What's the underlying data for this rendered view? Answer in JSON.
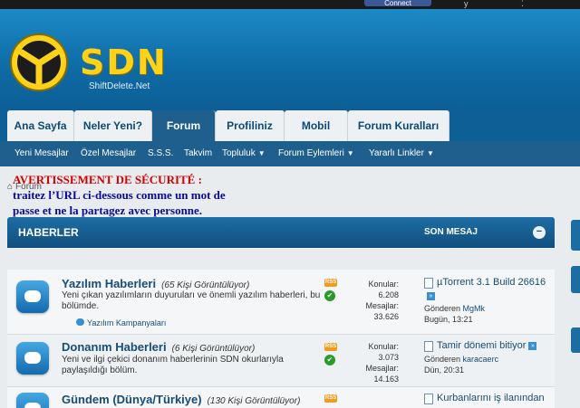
{
  "topbar": {
    "connect_label": "Connect"
  },
  "brand": {
    "logo_text": "SDN",
    "logo_sub": "ShiftDelete.Net",
    "accent": "#ffd21a",
    "primary": "#0d5f96"
  },
  "nav": {
    "tabs": [
      "Ana Sayfa",
      "Neler Yeni?",
      "Forum",
      "Profiliniz",
      "Mobil",
      "Forum Kuralları"
    ],
    "active": "Forum"
  },
  "subnav": {
    "items": [
      "Yeni Mesajlar",
      "Özel Mesajlar",
      "S.S.S.",
      "Takvim",
      "Topluluk",
      "Forum Eylemleri",
      "Yararlı Linkler"
    ]
  },
  "warning": {
    "title": "AVERTISSEMENT DE SÉCURITÉ :",
    "body": "traitez l’URL ci-dessous comme un mot de passe et ne la partagez avec personne."
  },
  "breadcrumb": {
    "label": "Forum"
  },
  "forum_header": {
    "title": "HABERLER",
    "last_post": "SON MESAJ"
  },
  "forums": [
    {
      "title": "Yazılım Haberleri",
      "viewers": "(65 Kişi Görüntülüyor)",
      "description": "Yeni çıkan yazılımların duyuruları ve önemli yazılım haberleri, bu bölümde.",
      "subforum": "Yazılım Kampanyaları",
      "rss_label": "RSS",
      "stats_labels": [
        "Konular:",
        "Mesajlar:"
      ],
      "topics": "6.208",
      "posts": "33.626",
      "last_title": "µTorrent 3.1 Build 26616",
      "last_by_label": "Gönderen",
      "last_user": "MgMk",
      "last_time": "Bugün, 13:21"
    },
    {
      "title": "Donanım Haberleri",
      "viewers": "(6 Kişi Görüntülüyor)",
      "description": "Yeni ve ilgi çekici donanım haberlerinin SDN okurlarıyla paylaşıldığı bölüm.",
      "subforum": "",
      "rss_label": "RSS",
      "stats_labels": [
        "Konular:",
        "Mesajlar:"
      ],
      "topics": "3.073",
      "posts": "14.163",
      "last_title": "Tamir dönemi bitiyor",
      "last_by_label": "Gönderen",
      "last_user": "karacaerc",
      "last_time": "Dün, 20:31"
    },
    {
      "title": "Gündem (Dünya/Türkiye)",
      "viewers": "(130 Kişi Görüntülüyor)",
      "description": "",
      "subforum": "",
      "rss_label": "RSS",
      "stats_labels": [
        "Konular:",
        "Mesajlar:"
      ],
      "topics": "",
      "posts": "",
      "last_title": "Kurbanlarını iş ilanından",
      "last_by_label": "",
      "last_user": "",
      "last_time": ""
    }
  ]
}
